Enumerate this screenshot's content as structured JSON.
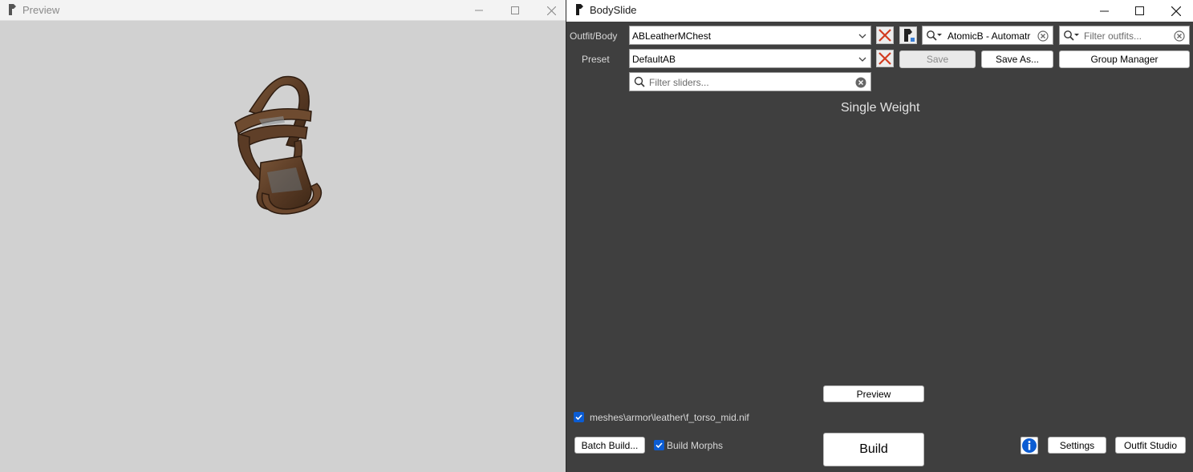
{
  "preview": {
    "title": "Preview",
    "icon": "bodyslide-app-icon"
  },
  "bodyslide": {
    "title": "BodySlide",
    "icon": "bodyslide-app-icon",
    "outfit": {
      "label": "Outfit/Body",
      "value": "ABLeatherMChest"
    },
    "preset": {
      "label": "Preset",
      "value": "DefaultAB"
    },
    "group_filter": {
      "value": "AtomicB - Automatr"
    },
    "outfit_filter": {
      "placeholder": "Filter outfits..."
    },
    "slider_filter": {
      "placeholder": "Filter sliders..."
    },
    "buttons": {
      "save": "Save",
      "save_as": "Save As...",
      "group_manager": "Group Manager",
      "preview": "Preview",
      "build": "Build",
      "batch_build": "Batch Build...",
      "settings": "Settings",
      "outfit_studio": "Outfit Studio"
    },
    "weight_heading": "Single Weight",
    "output_path": {
      "checked": true,
      "label": "meshes\\armor\\leather\\f_torso_mid.nif"
    },
    "build_morphs": {
      "checked": true,
      "label": "Build Morphs"
    },
    "colors": {
      "panel_bg": "#3f3f3f",
      "accent_blue": "#0b5cd3",
      "clear_x_red": "#d23b1f"
    }
  }
}
